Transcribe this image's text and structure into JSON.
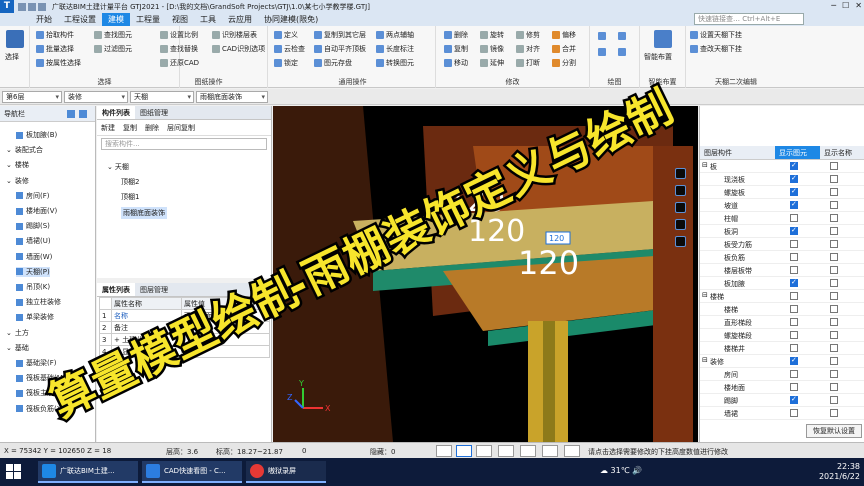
{
  "window": {
    "title": "广联达BIM土建计量平台 GTJ2021 - [D:\\我的文档\\GrandSoft Projects\\GTJ\\1.0\\某七小学教学楼.GTJ]",
    "search_placeholder": "快速链接查…  Ctrl+Alt+E"
  },
  "menu": [
    "开始",
    "工程设置",
    "建模",
    "工程量",
    "视图",
    "工具",
    "云应用",
    "协同建模(限免)"
  ],
  "menu_active": "建模",
  "ribbon": {
    "select": "选择",
    "select_group": "选择",
    "col1": [
      "拾取构件",
      "批量选择",
      "按属性选择"
    ],
    "col2": [
      "查找图元",
      "过滤图元"
    ],
    "col3": [
      "设置比例",
      "查找替换",
      "还原CAD"
    ],
    "col4": [
      "识别楼层表",
      "CAD识别选项"
    ],
    "cad_group": "图纸操作",
    "col5": [
      "定义",
      "云检查",
      "锁定"
    ],
    "col6": [
      "复制到其它层",
      "自动平齐顶板",
      "图元存盘"
    ],
    "col7": [
      "两点辅轴",
      "长度标注",
      "转换图元"
    ],
    "common_group": "通用操作",
    "col8": [
      "删除",
      "复制",
      "移动"
    ],
    "col9": [
      "旋转",
      "镜像",
      "延伸"
    ],
    "col10": [
      "修剪",
      "对齐",
      "打断"
    ],
    "col11": [
      "偏移",
      "合并",
      "分割"
    ],
    "modify_group": "修改",
    "draw_group": "绘图",
    "smart_label": "智能布置",
    "smart_group": "智能布置",
    "ceil": [
      "设置天棚下挂",
      "查改天棚下挂"
    ],
    "ceil_group": "天棚二次编辑"
  },
  "filters": [
    "第6层",
    "装修",
    "天棚",
    "雨棚底面装饰"
  ],
  "nav": {
    "title": "导航栏",
    "items": [
      {
        "label": "板加腋(B)",
        "indent": 2,
        "sel": false
      },
      {
        "label": "装配式合",
        "indent": 0,
        "sel": false
      },
      {
        "label": "楼梯",
        "indent": 0,
        "sel": false
      },
      {
        "label": "装修",
        "indent": 0,
        "sel": false
      },
      {
        "label": "房间(F)",
        "indent": 2,
        "sel": false
      },
      {
        "label": "楼地面(V)",
        "indent": 2,
        "sel": false
      },
      {
        "label": "踢脚(S)",
        "indent": 2,
        "sel": false
      },
      {
        "label": "墙裙(U)",
        "indent": 2,
        "sel": false
      },
      {
        "label": "墙面(W)",
        "indent": 2,
        "sel": false
      },
      {
        "label": "天棚(P)",
        "indent": 2,
        "sel": true
      },
      {
        "label": "吊顶(K)",
        "indent": 2,
        "sel": false
      },
      {
        "label": "独立柱装修",
        "indent": 2,
        "sel": false
      },
      {
        "label": "单梁装修",
        "indent": 2,
        "sel": false
      },
      {
        "label": "土方",
        "indent": 0,
        "sel": false
      },
      {
        "label": "基础",
        "indent": 0,
        "sel": false
      },
      {
        "label": "基础梁(F)",
        "indent": 2,
        "sel": false
      },
      {
        "label": "筏板基础(M)",
        "indent": 2,
        "sel": false
      },
      {
        "label": "筏板主筋(R)",
        "indent": 2,
        "sel": false
      },
      {
        "label": "筏板负筋(X)",
        "indent": 2,
        "sel": false
      }
    ]
  },
  "complist": {
    "tabs": [
      "构件列表",
      "图纸管理"
    ],
    "tools": [
      "新建",
      "复制",
      "删除",
      "层间复制"
    ],
    "search_placeholder": "搜索构件...",
    "tree": [
      {
        "label": "天棚",
        "level": 0,
        "sel": false
      },
      {
        "label": "顶棚2",
        "level": 1,
        "sel": false
      },
      {
        "label": "顶棚1",
        "level": 1,
        "sel": false
      },
      {
        "label": "雨棚底面装饰",
        "level": 1,
        "sel": true
      }
    ]
  },
  "props": {
    "tabs": [
      "属性列表",
      "图层管理"
    ],
    "header": [
      "属性名称",
      "属性值"
    ],
    "rows": [
      {
        "num": "1",
        "name": "名称",
        "val": "雨棚底面装饰"
      },
      {
        "num": "2",
        "name": "备注",
        "val": ""
      },
      {
        "num": "3",
        "name": "+ 土建业务属性",
        "val": ""
      },
      {
        "num": "4",
        "name": "+ 显示样式",
        "val": ""
      }
    ]
  },
  "viewport": {
    "dims": [
      "120",
      "120",
      "120"
    ],
    "tag": "120",
    "axes": [
      "X",
      "Y",
      "Z"
    ]
  },
  "display": {
    "header": [
      "图层构件",
      "显示图元",
      "显示名称"
    ],
    "rows": [
      {
        "label": "板",
        "grp": true,
        "show": true,
        "name": false
      },
      {
        "label": "现浇板",
        "grp": false,
        "show": true,
        "name": false
      },
      {
        "label": "螺旋板",
        "grp": false,
        "show": true,
        "name": false
      },
      {
        "label": "坡道",
        "grp": false,
        "show": true,
        "name": false
      },
      {
        "label": "柱帽",
        "grp": false,
        "show": false,
        "name": false
      },
      {
        "label": "板洞",
        "grp": false,
        "show": true,
        "name": false
      },
      {
        "label": "板受力筋",
        "grp": false,
        "show": false,
        "name": false
      },
      {
        "label": "板负筋",
        "grp": false,
        "show": false,
        "name": false
      },
      {
        "label": "楼层板带",
        "grp": false,
        "show": false,
        "name": false
      },
      {
        "label": "板加腋",
        "grp": false,
        "show": true,
        "name": false
      },
      {
        "label": "楼梯",
        "grp": true,
        "show": false,
        "name": false
      },
      {
        "label": "楼梯",
        "grp": false,
        "show": false,
        "name": false
      },
      {
        "label": "直形梯段",
        "grp": false,
        "show": false,
        "name": false
      },
      {
        "label": "螺旋梯段",
        "grp": false,
        "show": false,
        "name": false
      },
      {
        "label": "楼梯井",
        "grp": false,
        "show": false,
        "name": false
      },
      {
        "label": "装修",
        "grp": true,
        "show": true,
        "name": false
      },
      {
        "label": "房间",
        "grp": false,
        "show": false,
        "name": false
      },
      {
        "label": "楼地面",
        "grp": false,
        "show": false,
        "name": false
      },
      {
        "label": "踢脚",
        "grp": false,
        "show": true,
        "name": false
      },
      {
        "label": "墙裙",
        "grp": false,
        "show": false,
        "name": false
      }
    ],
    "reset": "恢复默认设置"
  },
  "status": {
    "coords": "X = 75342  Y = 102650  Z = 18",
    "layer_h": "层高：3.6",
    "elev": "标高：18.27~21.87",
    "zero": "0",
    "hidden": "隐藏：0",
    "hint": "请点击选择需要修改的下挂高度数值进行修改"
  },
  "taskbar": {
    "apps": [
      "广联达BIM土建...",
      "CAD快速看图 - C...",
      "嗷狱录屏"
    ],
    "temp": "31℃",
    "time": "22:38",
    "date": "2021/6/22"
  },
  "overlay": {
    "line1": "算量模型绘制",
    "line2": "-雨棚装饰定义与绘制"
  }
}
